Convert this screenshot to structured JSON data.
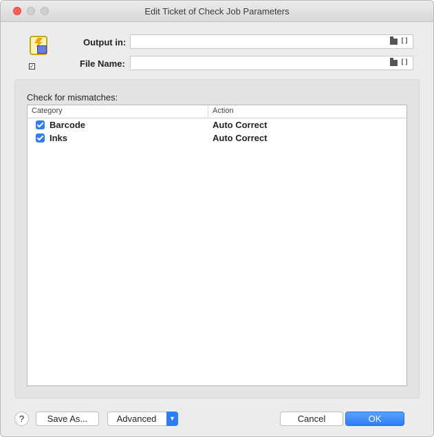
{
  "window": {
    "title": "Edit Ticket of Check Job Parameters"
  },
  "fields": {
    "output_label": "Output in:",
    "output_value": "",
    "file_label": "File Name:",
    "file_value": "",
    "folder_icon": "folder-icon",
    "brackets_icon": "[]"
  },
  "group": {
    "label": "Check for mismatches:",
    "columns": [
      "Category",
      "Action"
    ],
    "rows": [
      {
        "category": "Barcode",
        "action": "Auto Correct",
        "checked": true
      },
      {
        "category": "Inks",
        "action": "Auto Correct",
        "checked": true
      }
    ]
  },
  "footer": {
    "help_label": "?",
    "save_as_label": "Save As...",
    "advanced_label": "Advanced",
    "cancel_label": "Cancel",
    "ok_label": "OK"
  },
  "colors": {
    "accent": "#2e7cf6",
    "close": "#fd5f57"
  }
}
